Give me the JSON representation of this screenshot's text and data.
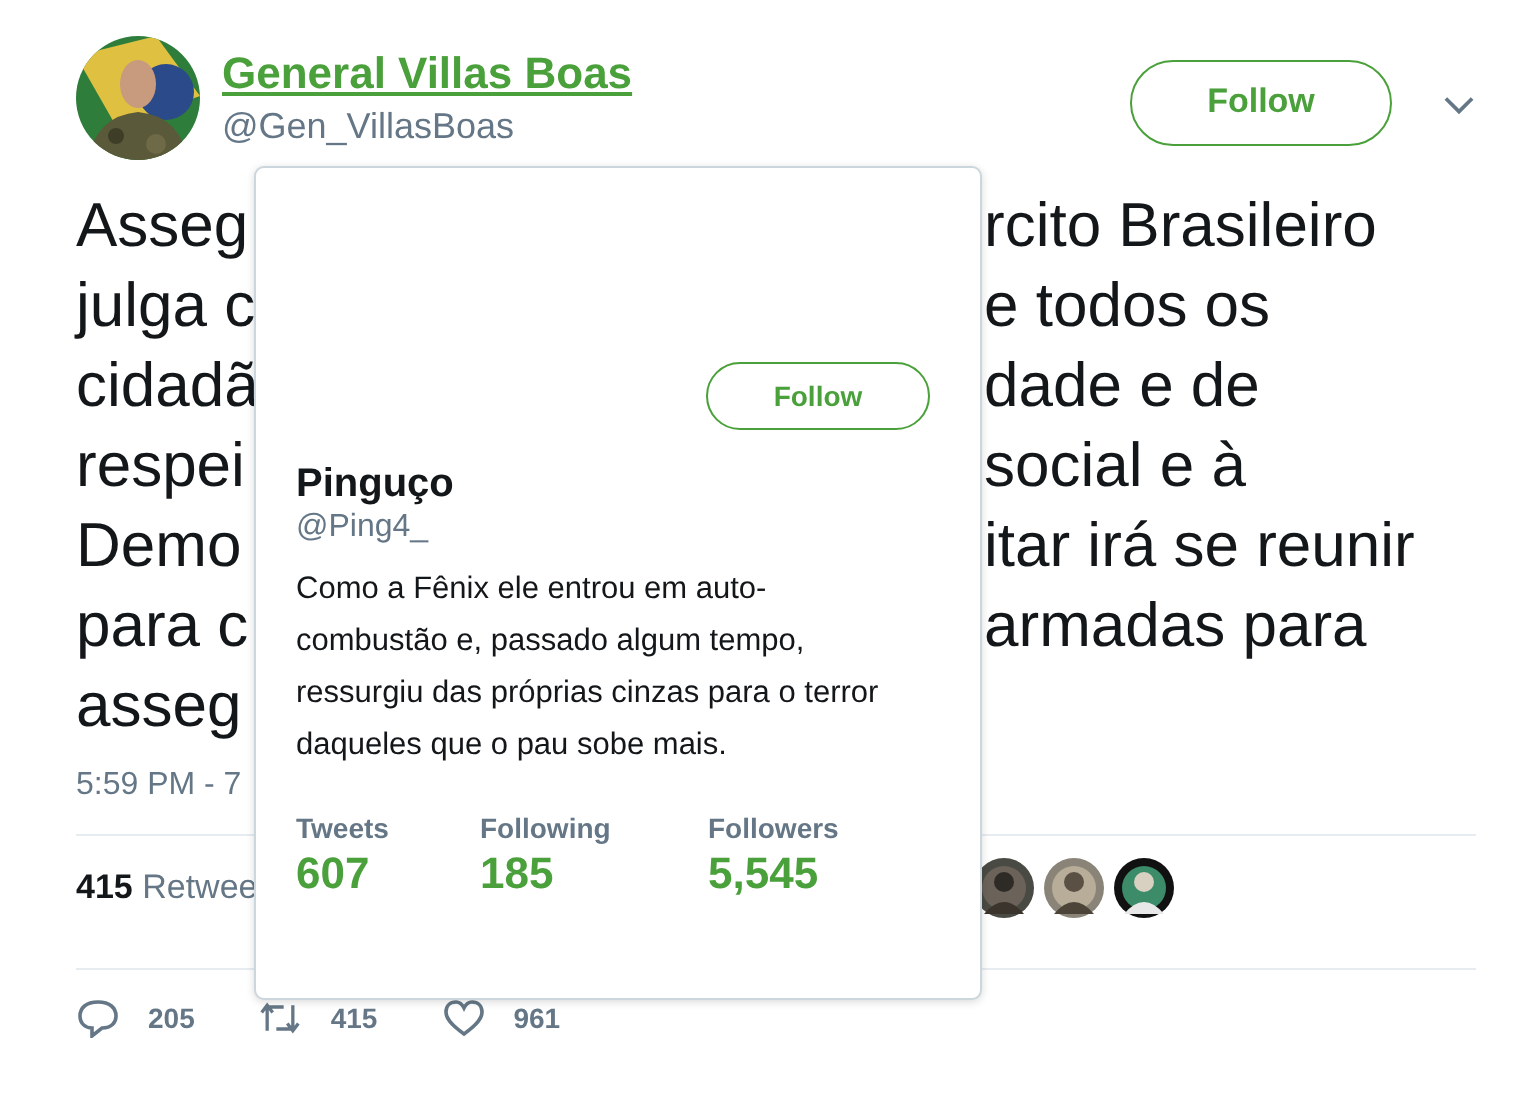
{
  "author": {
    "name": "General Villas Boas",
    "handle": "@Gen_VillasBoas",
    "follow": "Follow"
  },
  "tweet_lines": [
    {
      "left": "Asseg",
      "right": "rcito Brasileiro"
    },
    {
      "left": "julga c",
      "right": "e todos os"
    },
    {
      "left": "cidadã",
      "right": "dade e de"
    },
    {
      "left": "respei",
      "right": "social e à"
    },
    {
      "left": "Demo",
      "right": "itar irá se reunir"
    },
    {
      "left": "para c",
      "right": "armadas para"
    },
    {
      "left": "asseg"
    }
  ],
  "timestamp": "5:59 PM - 7",
  "retweets": {
    "count": "415",
    "label": "Retwee"
  },
  "actions": [
    {
      "kind": "reply",
      "count": "205"
    },
    {
      "kind": "retweet",
      "count": "415"
    },
    {
      "kind": "like",
      "count": "961"
    }
  ],
  "profile_card": {
    "follow": "Follow",
    "name": "Pinguço",
    "handle": "@Ping4_",
    "bio": "Como a Fênix ele entrou em auto-combustão e, passado algum tempo, ressurgiu das próprias cinzas para o terror daqueles que o pau sobe mais.",
    "stats": [
      {
        "label": "Tweets",
        "value": "607"
      },
      {
        "label": "Following",
        "value": "185"
      },
      {
        "label": "Followers",
        "value": "5,545"
      }
    ]
  }
}
